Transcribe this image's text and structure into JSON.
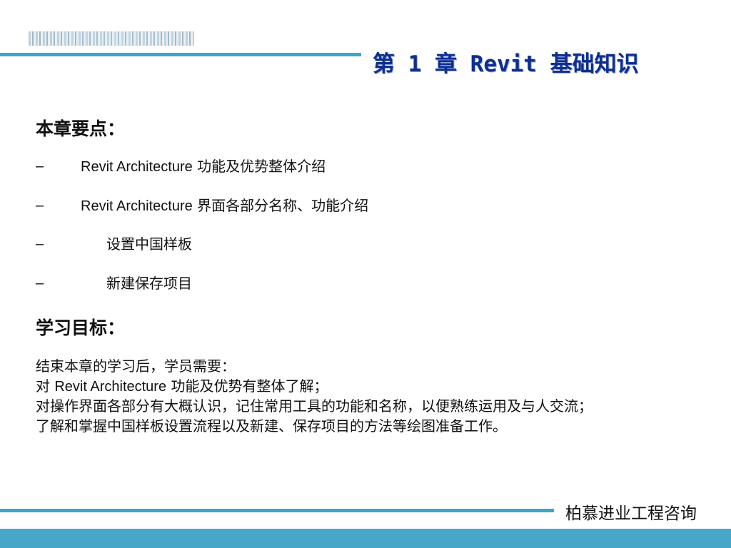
{
  "header": {
    "chapter_title": "第 1 章  Revit  基础知识"
  },
  "section_key_points": {
    "heading": "本章要点：",
    "bullets": [
      {
        "dash": "–",
        "text_en": "Revit Architecture",
        "text_cn": "  功能及优势整体介绍"
      },
      {
        "dash": "–",
        "text_en": "Revit Architecture",
        "text_cn": " 界面各部分名称、功能介绍"
      },
      {
        "dash": "–",
        "text_en": "",
        "text_cn": "设置中国样板"
      },
      {
        "dash": "–",
        "text_en": "",
        "text_cn": "新建保存项目"
      }
    ]
  },
  "section_goals": {
    "heading": "学习目标：",
    "lines": [
      {
        "prefix": "",
        "en": "",
        "suffix": "结束本章的学习后，学员需要："
      },
      {
        "prefix": "对 ",
        "en": "Revit Architecture",
        "suffix": " 功能及优势有整体了解；"
      },
      {
        "prefix": "",
        "en": "",
        "suffix": "对操作界面各部分有大概认识，记住常用工具的功能和名称，以便熟练运用及与人交流；"
      },
      {
        "prefix": "",
        "en": "",
        "suffix": "了解和掌握中国样板设置流程以及新建、保存项目的方法等绘图准备工作。"
      }
    ]
  },
  "footer": {
    "company": "柏慕进业工程咨询"
  },
  "colors": {
    "accent": "#3aa7c7",
    "title": "#0f2f8f"
  }
}
